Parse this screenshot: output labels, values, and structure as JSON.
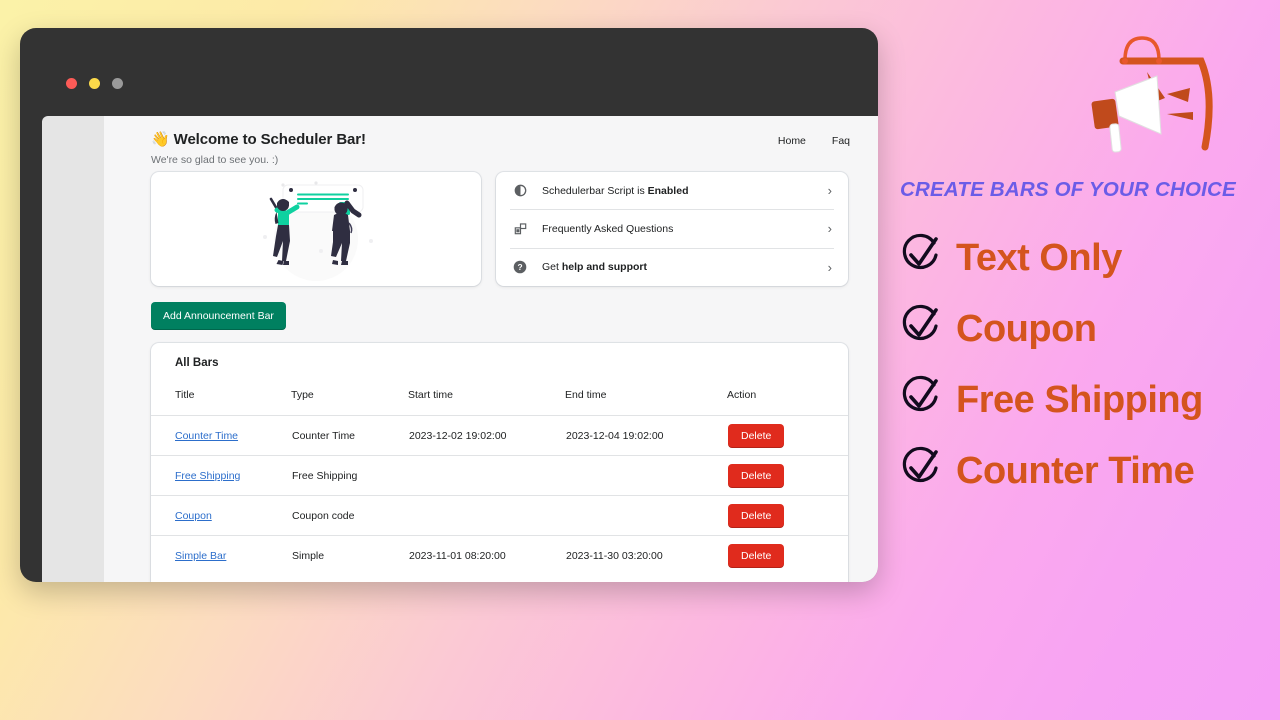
{
  "window": {
    "dots": [
      "close",
      "minimize",
      "maximize"
    ]
  },
  "header": {
    "wave_emoji": "👋",
    "title": "Welcome to Scheduler Bar!",
    "subtitle": "We're so glad to see you. :)",
    "nav": [
      {
        "label": "Home"
      },
      {
        "label": "Faq"
      }
    ]
  },
  "info_card": {
    "rows": [
      {
        "icon": "toggle-icon",
        "text_prefix": "Schedulerbar Script is ",
        "text_bold": "Enabled",
        "text_suffix": ""
      },
      {
        "icon": "faq-blocks-icon",
        "text_prefix": "Frequently Asked Questions",
        "text_bold": "",
        "text_suffix": ""
      },
      {
        "icon": "question-circle-icon",
        "text_prefix": "Get ",
        "text_bold": "help and support",
        "text_suffix": ""
      }
    ],
    "chevron": "›"
  },
  "actions": {
    "add_bar_label": "Add Announcement Bar"
  },
  "table": {
    "title": "All Bars",
    "columns": [
      "Title",
      "Type",
      "Start time",
      "End time",
      "Action"
    ],
    "delete_label": "Delete",
    "rows": [
      {
        "title": "Counter Time",
        "type": "Counter Time",
        "start_time": "2023-12-02 19:02:00",
        "end_time": "2023-12-04 19:02:00"
      },
      {
        "title": "Free Shipping",
        "type": "Free Shipping",
        "start_time": "",
        "end_time": ""
      },
      {
        "title": "Coupon",
        "type": "Coupon code",
        "start_time": "",
        "end_time": ""
      },
      {
        "title": "Simple Bar",
        "type": "Simple",
        "start_time": "2023-11-01 08:20:00",
        "end_time": "2023-11-30 03:20:00"
      }
    ]
  },
  "promo": {
    "heading": "CREATE BARS OF YOUR CHOICE",
    "art": "megaphone-shopping-bag-illustration",
    "items": [
      {
        "icon": "check-circle-icon",
        "label": "Text Only"
      },
      {
        "icon": "check-circle-icon",
        "label": "Coupon"
      },
      {
        "icon": "check-circle-icon",
        "label": "Free Shipping"
      },
      {
        "icon": "check-circle-icon",
        "label": "Counter Time"
      }
    ]
  },
  "colors": {
    "primary_green": "#008060",
    "danger_red": "#e02b1d",
    "link_blue": "#2c6ecb",
    "promo_heading": "#6b5ce7",
    "promo_label": "#d4541e"
  }
}
